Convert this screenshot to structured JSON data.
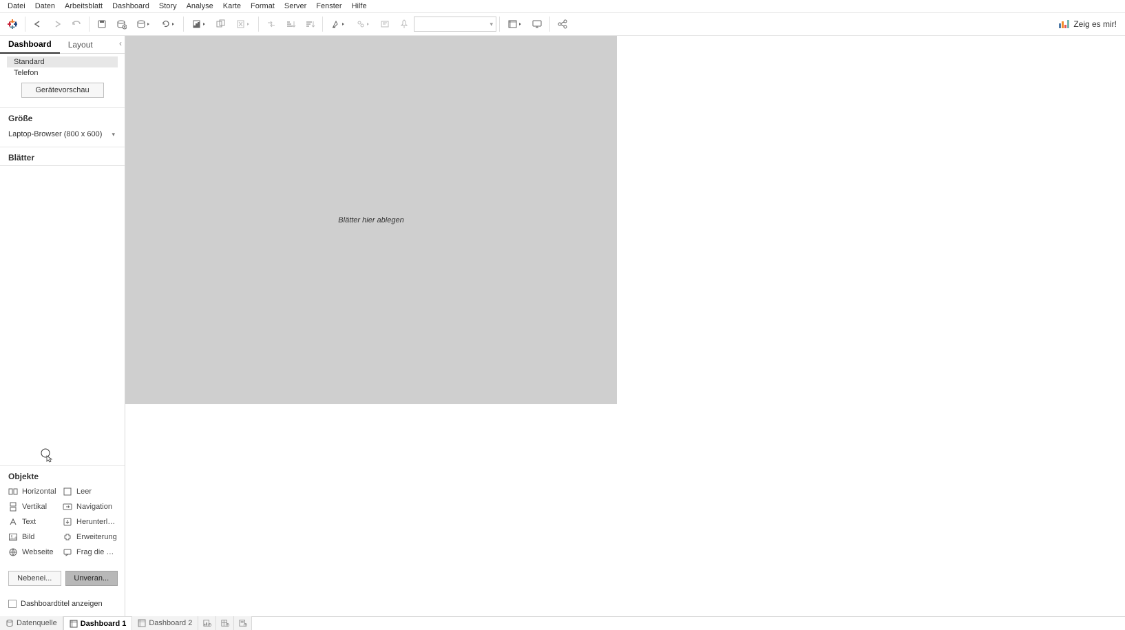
{
  "menu": {
    "items": [
      "Datei",
      "Daten",
      "Arbeitsblatt",
      "Dashboard",
      "Story",
      "Analyse",
      "Karte",
      "Format",
      "Server",
      "Fenster",
      "Hilfe"
    ]
  },
  "toolbar": {
    "show_me_label": "Zeig es mir!"
  },
  "sidebar": {
    "tabs": {
      "dashboard": "Dashboard",
      "layout": "Layout"
    },
    "devices": {
      "standard": "Standard",
      "telefon": "Telefon"
    },
    "preview_button": "Gerätevorschau",
    "size_heading": "Größe",
    "size_value": "Laptop-Browser (800 x 600)",
    "sheets_heading": "Blätter",
    "objects_heading": "Objekte",
    "objects": {
      "horizontal": "Horizontal",
      "vertikal": "Vertikal",
      "text": "Text",
      "bild": "Bild",
      "webseite": "Webseite",
      "leer": "Leer",
      "navigation": "Navigation",
      "herunterladen": "Herunterla...",
      "erweiterung": "Erweiterung",
      "frag": "Frag die D..."
    },
    "layout_mode": {
      "tiled": "Nebenei...",
      "floating": "Unveran..."
    },
    "show_title_label": "Dashboardtitel anzeigen"
  },
  "canvas": {
    "placeholder": "Blätter hier ablegen"
  },
  "bottom_tabs": {
    "datasource": "Datenquelle",
    "dashboard1": "Dashboard 1",
    "dashboard2": "Dashboard 2"
  }
}
